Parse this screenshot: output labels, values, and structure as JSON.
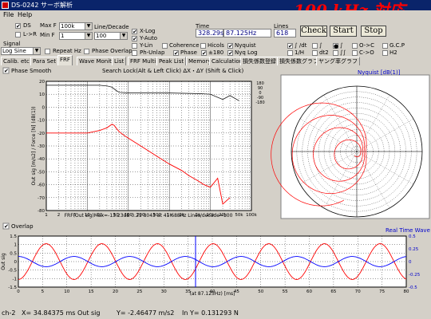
{
  "window": {
    "title": "DS-0242 サーボ解析"
  },
  "promo": "100 kHz 対応",
  "menu": [
    "File",
    "Help"
  ],
  "controls": {
    "ds": "DS",
    "l_r": "L->R",
    "max_f_label": "Max F",
    "max_f_value": "100k",
    "min_f_label": "Min F",
    "min_f_value": "1",
    "line_decade_label": "Line/Decade",
    "line_decade_value": "100",
    "x_log": "X-Log",
    "y_auto": "Y-Auto",
    "y_lin": "Y-Lin",
    "coherence": "Coherence",
    "hicols": "Hicols",
    "nyquist": "Nyquist",
    "ph_unlap": "Ph-Unlap",
    "phase": "Phase",
    "pm180": "±180",
    "nyq_log": "Nyq Log",
    "signal_label": "Signal",
    "signal_value": "Log Sine",
    "repeat_hz": "Repeat Hz",
    "phase_overlap": "Phase Overlap",
    "time_label": "Time",
    "time_value": "328.29s",
    "freq_value": "87.125Hz",
    "lines_label": "Lines",
    "lines_value": "618",
    "check": "Check",
    "start": "Start",
    "stop": "Stop",
    "opt_s_dt": "∫ /dt",
    "opt_dt2": "dt2",
    "opt_s1": "∫",
    "opt_s2": "∫∫",
    "opt_1h": "1/H",
    "opt_0a": "O->C",
    "opt_0b": "C->O",
    "gcp": "G.C.P",
    "h2": "H2"
  },
  "tabs": [
    "Calib. etc",
    "Para Set",
    "FRF",
    "Wave Monitor",
    "List",
    "FRF Multi",
    "Peak List",
    "Memory",
    "Calculation",
    "損失係数登録",
    "損失係数グラフ",
    "ヤング率グラフ"
  ],
  "active_tab": 2,
  "frf": {
    "phase_smooth": "Phase Smooth",
    "search_hint": "Search Lock(Alt & Left Click)  ΔX・ΔY (Shift & Click)",
    "yaxis_label": "Out sig [m/s2] / Force [N]  (dB(1))",
    "xlabel": "FRF(Out sig)Max=-13.23dB 0.21 8043 at 41.688Hz  Lines/decade=100",
    "yticks": [
      "20",
      "10",
      "0",
      "-10",
      "-20",
      "-30",
      "-40",
      "-50",
      "-60",
      "-70",
      "-80"
    ],
    "xticks": [
      "1",
      "2",
      "5",
      "10",
      "20",
      "50",
      "100",
      "200",
      "500",
      "1k",
      "2k",
      "5k",
      "10k",
      "20k",
      "50k",
      "100k"
    ],
    "phase_ticks": [
      "180",
      "90",
      "0",
      "-90",
      "-180"
    ]
  },
  "nyquist": {
    "title": "Nyquist [dB(1)]"
  },
  "wave": {
    "overlap": "Overlap",
    "legend": "Real Time Wave",
    "yaxis_label": "Out sig",
    "left_ticks": [
      "1.5",
      "1",
      "0.5",
      "0",
      "-0.5",
      "-1",
      "-1.5"
    ],
    "right_ticks": [
      "0.5",
      "0.25",
      "0",
      "-0.25",
      "-0.5"
    ],
    "xticks": [
      "0",
      "5",
      "10",
      "15",
      "20",
      "25",
      "30",
      "35",
      "40",
      "45",
      "50",
      "55",
      "60",
      "65",
      "70",
      "75",
      "80"
    ],
    "xlabel": "(at 87.125Hz) [ms]"
  },
  "status": {
    "ch": "ch-2",
    "x": "X=  34.84375 ms Out sig",
    "y": "Y=  -2.46477 m/s2",
    "in": "In Y=  0.131293 N"
  },
  "chart_data": [
    {
      "type": "line",
      "title": "",
      "xlabel": "FRF(Out sig)Max=-13.23dB 0.21 8043 at 41.688Hz  Lines/decade=100",
      "ylabel": "Out sig [m/s2] / Force [N]  (dB(1))",
      "xscale": "log",
      "xlim": [
        1,
        100000
      ],
      "ylim": [
        -80,
        20
      ],
      "grid": true,
      "series": [
        {
          "color": "#ff0000",
          "x": [
            1,
            2,
            5,
            10,
            20,
            30,
            40,
            45,
            50,
            60,
            80,
            100,
            200,
            500,
            1000,
            2000,
            3000,
            5000,
            7000,
            10000,
            15000,
            20000,
            30000
          ],
          "y": [
            -20,
            -20,
            -20,
            -20,
            -18,
            -16,
            -13.2,
            -14,
            -16,
            -19,
            -22,
            -24,
            -30,
            -38,
            -44,
            -49,
            -53,
            -57,
            -60,
            -62,
            -55,
            -75,
            -70
          ]
        },
        {
          "color": "#000000",
          "x": [
            1,
            10,
            20,
            30,
            40,
            50,
            60,
            100,
            1000,
            5000,
            10000,
            20000,
            30000,
            50000
          ],
          "y": [
            17,
            17,
            17,
            16.5,
            15.5,
            13,
            11.5,
            11,
            11,
            10.5,
            10,
            6,
            9,
            5
          ]
        }
      ]
    },
    {
      "type": "line",
      "title": "Real Time Wave",
      "xlabel": "(at 87.125Hz) [ms]",
      "ylabel": "Out sig",
      "xlim": [
        0,
        80
      ],
      "ylim": [
        -1.5,
        1.5
      ],
      "grid": true,
      "series": [
        {
          "color": "#ff0000",
          "amplitude": 1.05,
          "frequency_hz": 87.125,
          "phase_deg": -90
        },
        {
          "color": "#0000ff",
          "amplitude": 0.3,
          "frequency_hz": 87.125,
          "phase_deg": 90
        }
      ]
    }
  ]
}
